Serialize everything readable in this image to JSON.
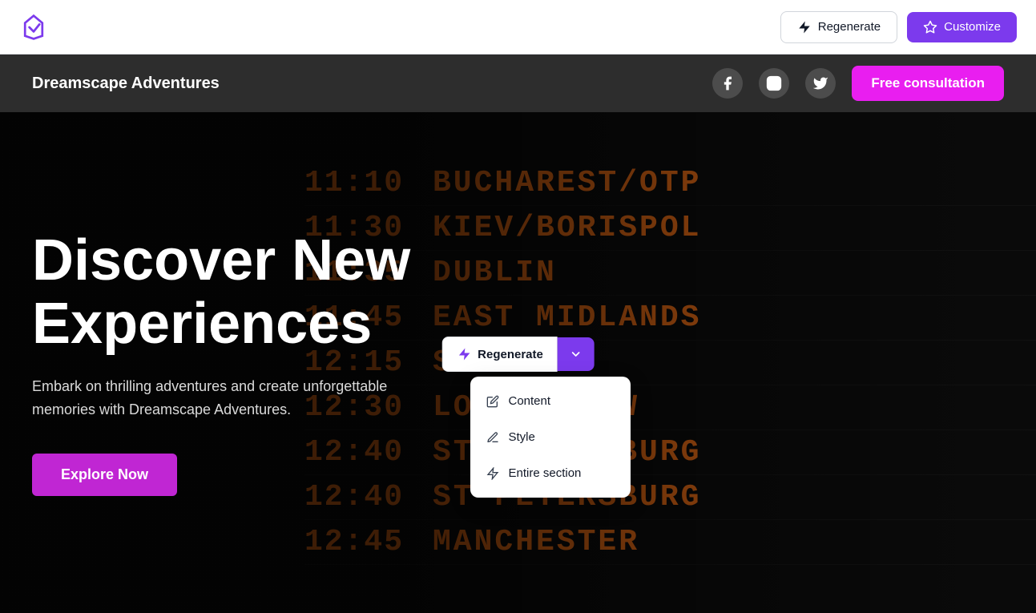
{
  "toolbar": {
    "regenerate_label": "Regenerate",
    "customize_label": "Customize"
  },
  "site_nav": {
    "brand": "Dreamscape Adventures",
    "cta_label": "Free consultation",
    "social": [
      {
        "name": "facebook",
        "label": "Facebook"
      },
      {
        "name": "instagram",
        "label": "Instagram"
      },
      {
        "name": "twitter",
        "label": "Twitter"
      }
    ]
  },
  "hero": {
    "title": "Discover New Experiences",
    "subtitle": "Embark on thrilling adventures and create unforgettable memories with Dreamscape Adventures.",
    "cta_label": "Explore Now"
  },
  "departure_board": {
    "rows": [
      {
        "time": "11:10",
        "dest": "BUCHAREST/OTP"
      },
      {
        "time": "11:30",
        "dest": "KIEV/BORISPOL"
      },
      {
        "time": "11:35",
        "dest": "DUBLIN"
      },
      {
        "time": "11:45",
        "dest": "EAST MIDLANDS"
      },
      {
        "time": "12:15",
        "dest": "SOFIA"
      },
      {
        "time": "12:30",
        "dest": "LONDON/LGW"
      },
      {
        "time": "12:40",
        "dest": "ST PETERSBURG"
      },
      {
        "time": "12:40",
        "dest": "ST PETERSBURG"
      },
      {
        "time": "12:45",
        "dest": "MANCHESTER"
      }
    ]
  },
  "regen_dropdown": {
    "button_label": "Regenerate",
    "items": [
      {
        "label": "Content",
        "icon": "edit-icon"
      },
      {
        "label": "Style",
        "icon": "style-icon"
      },
      {
        "label": "Entire section",
        "icon": "lightning-icon"
      }
    ]
  },
  "colors": {
    "purple": "#7c3aed",
    "magenta": "#e91ef0",
    "explore_btn": "#c026d3"
  }
}
